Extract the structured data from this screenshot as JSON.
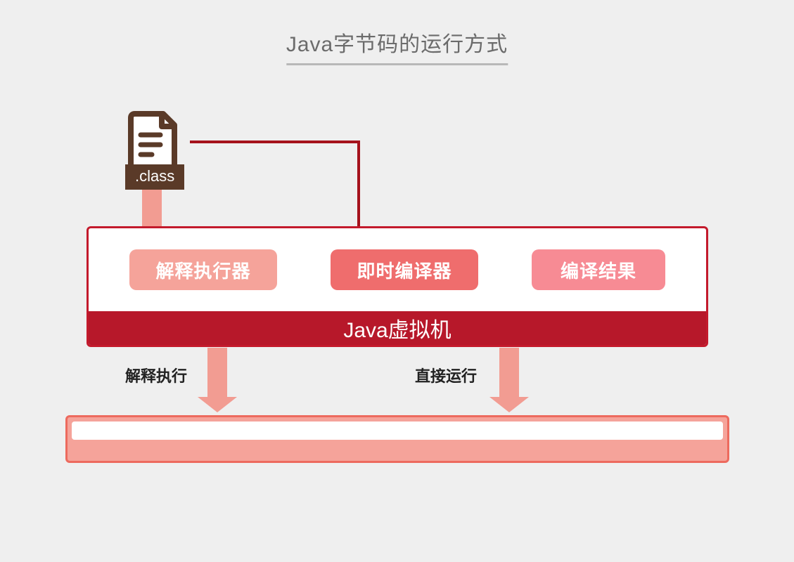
{
  "title": "Java字节码的运行方式",
  "file_label": ".class",
  "jvm": {
    "title": "Java虚拟机",
    "components": {
      "interpreter": "解释执行器",
      "jit": "即时编译器",
      "compiled": "编译结果"
    }
  },
  "labels": {
    "interpret_exec": "解释执行",
    "direct_run": "直接运行"
  }
}
